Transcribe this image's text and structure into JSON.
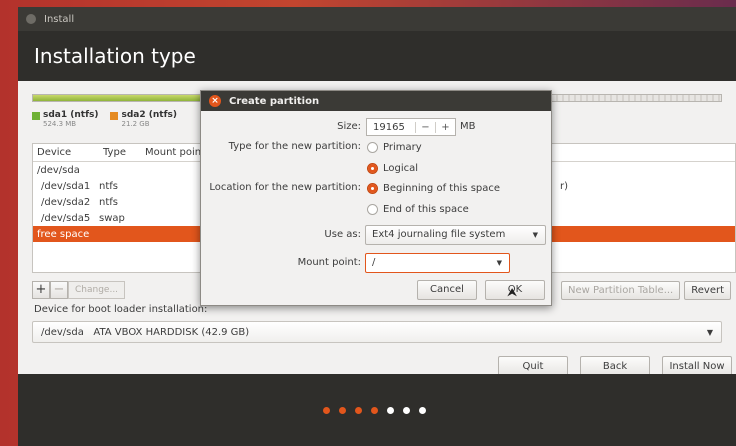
{
  "window": {
    "title": "Install"
  },
  "header": {
    "title": "Installation type"
  },
  "partition_bar": {
    "legend": [
      {
        "name": "sda1 (ntfs)",
        "size": "524.3 MB",
        "color": "#6fb135"
      },
      {
        "name": "sda2 (ntfs)",
        "size": "21.2 GB",
        "color": "#e58a21"
      }
    ]
  },
  "table": {
    "headers": [
      "Device",
      "Type",
      "Mount point"
    ],
    "rows": [
      {
        "device": "/dev/sda",
        "type": "",
        "mount": ""
      },
      {
        "device": "/dev/sda1",
        "type": "ntfs",
        "mount": ""
      },
      {
        "device": "/dev/sda2",
        "type": "ntfs",
        "mount": ""
      },
      {
        "device": "/dev/sda5",
        "type": "swap",
        "mount": ""
      },
      {
        "device": "free space",
        "type": "",
        "mount": "",
        "selected": true
      }
    ],
    "partial_visible_text": "r)",
    "add_label": "+",
    "remove_label": "−",
    "change_label": "Change..."
  },
  "table_actions": {
    "new_partition_table": "New Partition Table...",
    "revert": "Revert"
  },
  "boot_loader": {
    "label": "Device for boot loader installation:",
    "value": "/dev/sda   ATA VBOX HARDDISK (42.9 GB)"
  },
  "nav": {
    "quit": "Quit",
    "back": "Back",
    "install_now": "Install Now"
  },
  "progress": {
    "total_steps": 7,
    "completed_steps": 4,
    "done_color": "#e2561c",
    "todo_color": "#ffffff"
  },
  "dialog": {
    "title": "Create partition",
    "size_label": "Size:",
    "size_value": "19165",
    "size_minus": "−",
    "size_plus": "+",
    "size_unit": "MB",
    "type_label": "Type for the new partition:",
    "type_primary": "Primary",
    "type_logical": "Logical",
    "type_selected": "Logical",
    "location_label": "Location for the new partition:",
    "location_begin": "Beginning of this space",
    "location_end": "End of this space",
    "location_selected": "Beginning of this space",
    "use_as_label": "Use as:",
    "use_as_value": "Ext4 journaling file system",
    "mount_label": "Mount point:",
    "mount_value": "/",
    "cancel": "Cancel",
    "ok": "OK"
  }
}
